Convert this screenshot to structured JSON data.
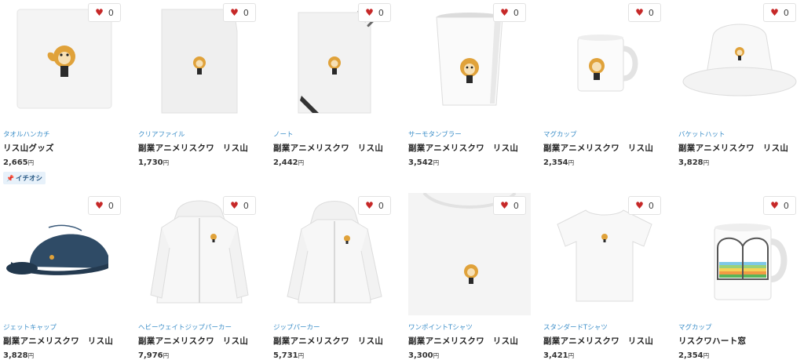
{
  "products": [
    {
      "category": "タオルハンカチ",
      "title": "リス山グッズ",
      "price": "2,665",
      "currency": "円",
      "likes": "0",
      "badge": "イチオシ"
    },
    {
      "category": "クリアファイル",
      "title": "副業アニメリスクワ　リス山",
      "price": "1,730",
      "currency": "円",
      "likes": "0"
    },
    {
      "category": "ノート",
      "title": "副業アニメリスクワ　リス山",
      "price": "2,442",
      "currency": "円",
      "likes": "0"
    },
    {
      "category": "サーモタンブラー",
      "title": "副業アニメリスクワ　リス山",
      "price": "3,542",
      "currency": "円",
      "likes": "0"
    },
    {
      "category": "マグカップ",
      "title": "副業アニメリスクワ　リス山",
      "price": "2,354",
      "currency": "円",
      "likes": "0"
    },
    {
      "category": "バケットハット",
      "title": "副業アニメリスクワ　リス山",
      "price": "3,828",
      "currency": "円",
      "likes": "0"
    },
    {
      "category": "ジェットキャップ",
      "title": "副業アニメリスクワ　リス山",
      "price": "3,828",
      "currency": "円",
      "likes": "0"
    },
    {
      "category": "ヘビーウェイトジップパーカー",
      "title": "副業アニメリスクワ　リス山",
      "price": "7,976",
      "currency": "円",
      "likes": "0"
    },
    {
      "category": "ジップパーカー",
      "title": "副業アニメリスクワ　リス山",
      "price": "5,731",
      "currency": "円",
      "likes": "0"
    },
    {
      "category": "ワンポイントTシャツ",
      "title": "副業アニメリスクワ　リス山",
      "price": "3,300",
      "currency": "円",
      "likes": "0"
    },
    {
      "category": "スタンダードTシャツ",
      "title": "副業アニメリスクワ　リス山",
      "price": "3,421",
      "currency": "円",
      "likes": "0"
    },
    {
      "category": "マグカップ",
      "title": "リスクワハート窓",
      "price": "2,354",
      "currency": "円",
      "likes": "0"
    }
  ],
  "icons": {
    "favorite": "heart-icon",
    "badge": "pin-icon"
  },
  "colors": {
    "heart": "#c62828",
    "category": "#3d8fc9",
    "badge_bg": "#e7f1fa"
  }
}
